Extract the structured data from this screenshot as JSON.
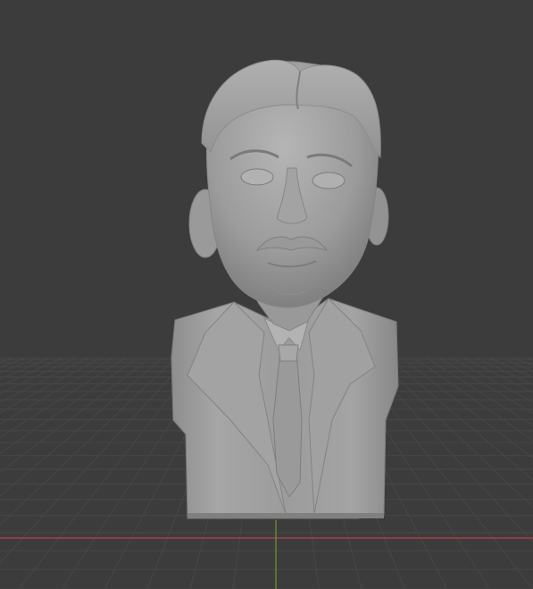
{
  "viewport": {
    "background_color": "#3c3c3c",
    "grid_color": "#4a4a4a",
    "x_axis_color": "#b8414b",
    "y_axis_color": "#6c9a2a",
    "object_color": "#9a9a9a",
    "object_name": "sculpted bust"
  }
}
